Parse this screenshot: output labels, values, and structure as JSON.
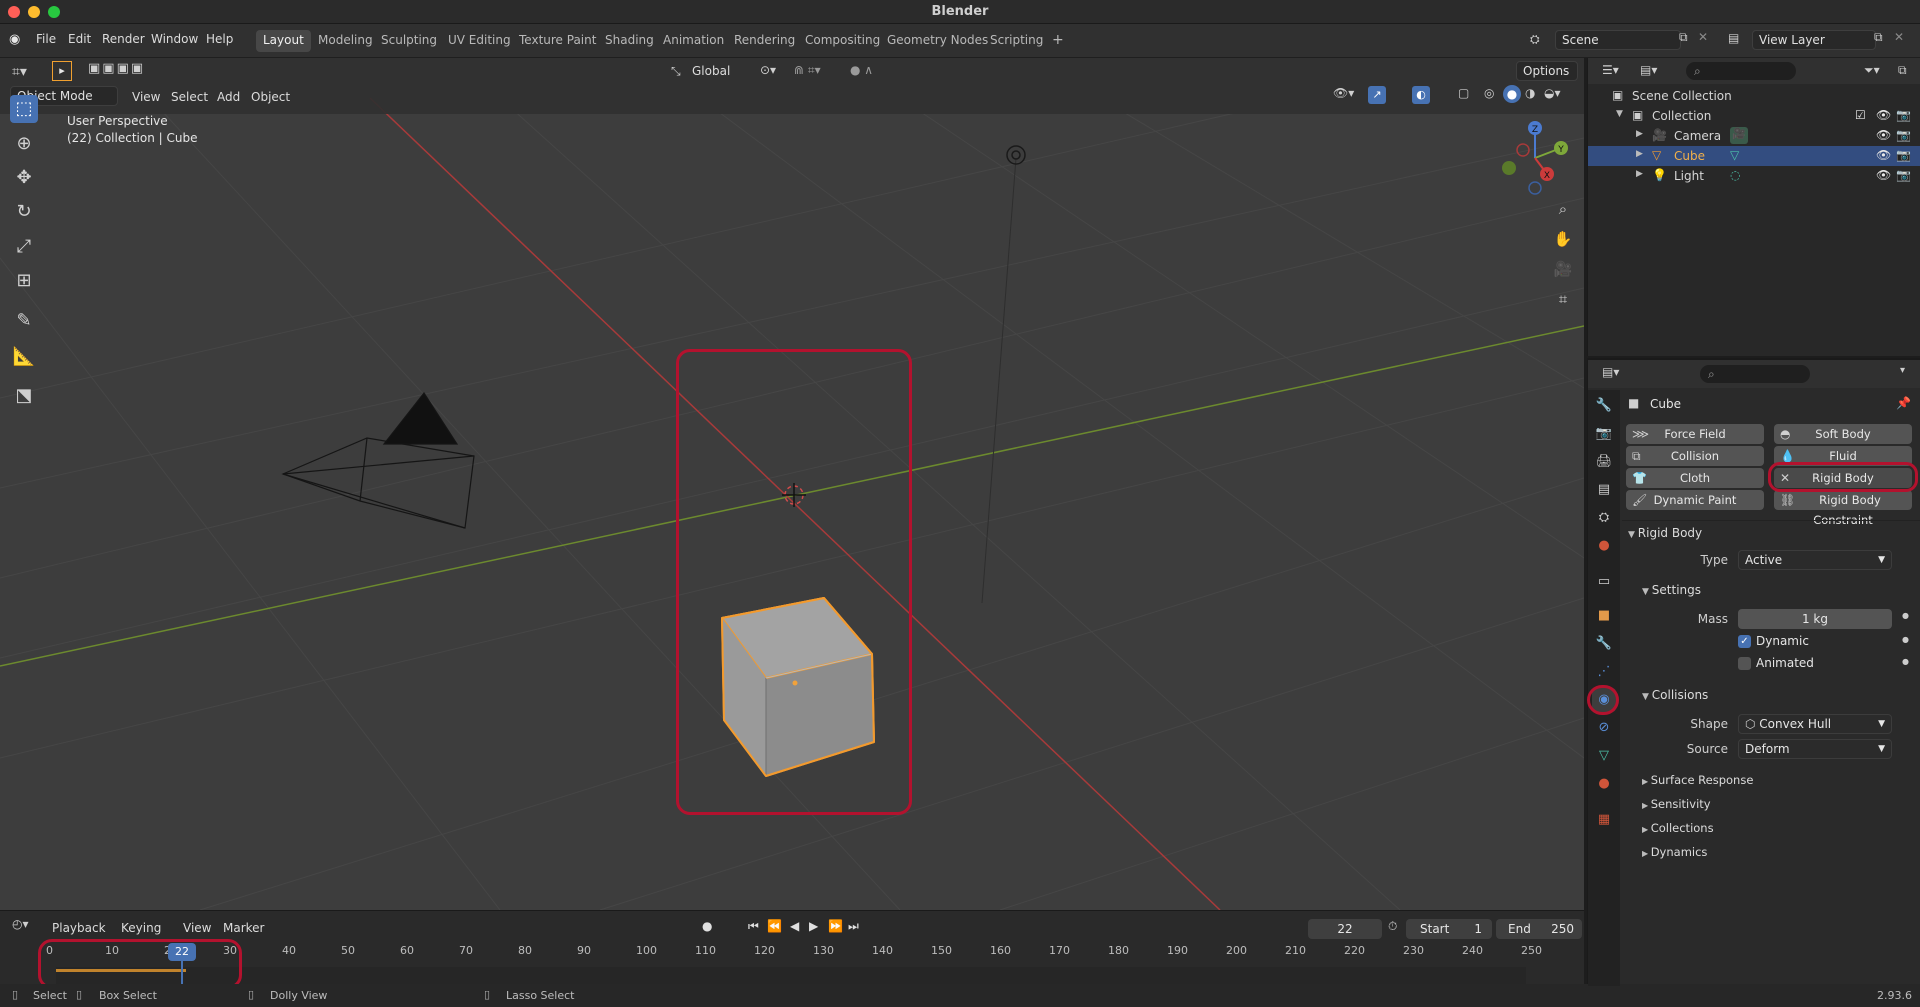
{
  "app": {
    "title": "Blender",
    "version": "2.93.6"
  },
  "menu": [
    "File",
    "Edit",
    "Render",
    "Window",
    "Help"
  ],
  "workspaces": [
    "Layout",
    "Modeling",
    "Sculpting",
    "UV Editing",
    "Texture Paint",
    "Shading",
    "Animation",
    "Rendering",
    "Compositing",
    "Geometry Nodes",
    "Scripting"
  ],
  "active_workspace": "Layout",
  "scene": {
    "name": "Scene",
    "view_layer": "View Layer"
  },
  "toolsettings": {
    "orientation": "Global",
    "options": "Options"
  },
  "viewport": {
    "mode": "Object Mode",
    "menus": [
      "View",
      "Select",
      "Add",
      "Object"
    ],
    "perspective": "User Perspective",
    "collection_info": "(22) Collection | Cube",
    "gizmo_axes": [
      "Z",
      "Y",
      "X"
    ]
  },
  "outliner": {
    "root": "Scene Collection",
    "collection": "Collection",
    "items": [
      {
        "name": "Camera",
        "selected": false
      },
      {
        "name": "Cube",
        "selected": true
      },
      {
        "name": "Light",
        "selected": false
      }
    ]
  },
  "properties": {
    "object_name": "Cube",
    "physics_buttons": [
      [
        "Force Field",
        "Soft Body"
      ],
      [
        "Collision",
        "Fluid"
      ],
      [
        "Cloth",
        "Rigid Body"
      ],
      [
        "Dynamic Paint",
        "Rigid Body Constraint"
      ]
    ],
    "rigid_body": {
      "title": "Rigid Body",
      "type_label": "Type",
      "type_value": "Active",
      "settings_title": "Settings",
      "mass_label": "Mass",
      "mass_value": "1 kg",
      "dynamic_label": "Dynamic",
      "dynamic_checked": true,
      "animated_label": "Animated",
      "animated_checked": false,
      "collisions_title": "Collisions",
      "shape_label": "Shape",
      "shape_value": "Convex Hull",
      "source_label": "Source",
      "source_value": "Deform",
      "collapsed_sections": [
        "Surface Response",
        "Sensitivity",
        "Collections",
        "Dynamics"
      ]
    }
  },
  "timeline": {
    "menus": [
      "Playback",
      "Keying",
      "View",
      "Marker"
    ],
    "current_frame": "22",
    "start_label": "Start",
    "start": "1",
    "end_label": "End",
    "end": "250",
    "ticks": [
      "0",
      "10",
      "20",
      "30",
      "40",
      "50",
      "60",
      "70",
      "80",
      "90",
      "100",
      "110",
      "120",
      "130",
      "140",
      "150",
      "160",
      "170",
      "180",
      "190",
      "200",
      "210",
      "220",
      "230",
      "240",
      "250"
    ]
  },
  "statusbar": {
    "items": [
      "Select",
      "Box Select",
      "Dolly View",
      "Lasso Select"
    ]
  },
  "colors": {
    "accent": "#4772b3",
    "highlight_red": "#b3122e",
    "selected_orange": "#f29a2e",
    "x_axis": "#cc3b3b",
    "y_axis": "#7ea83a"
  }
}
